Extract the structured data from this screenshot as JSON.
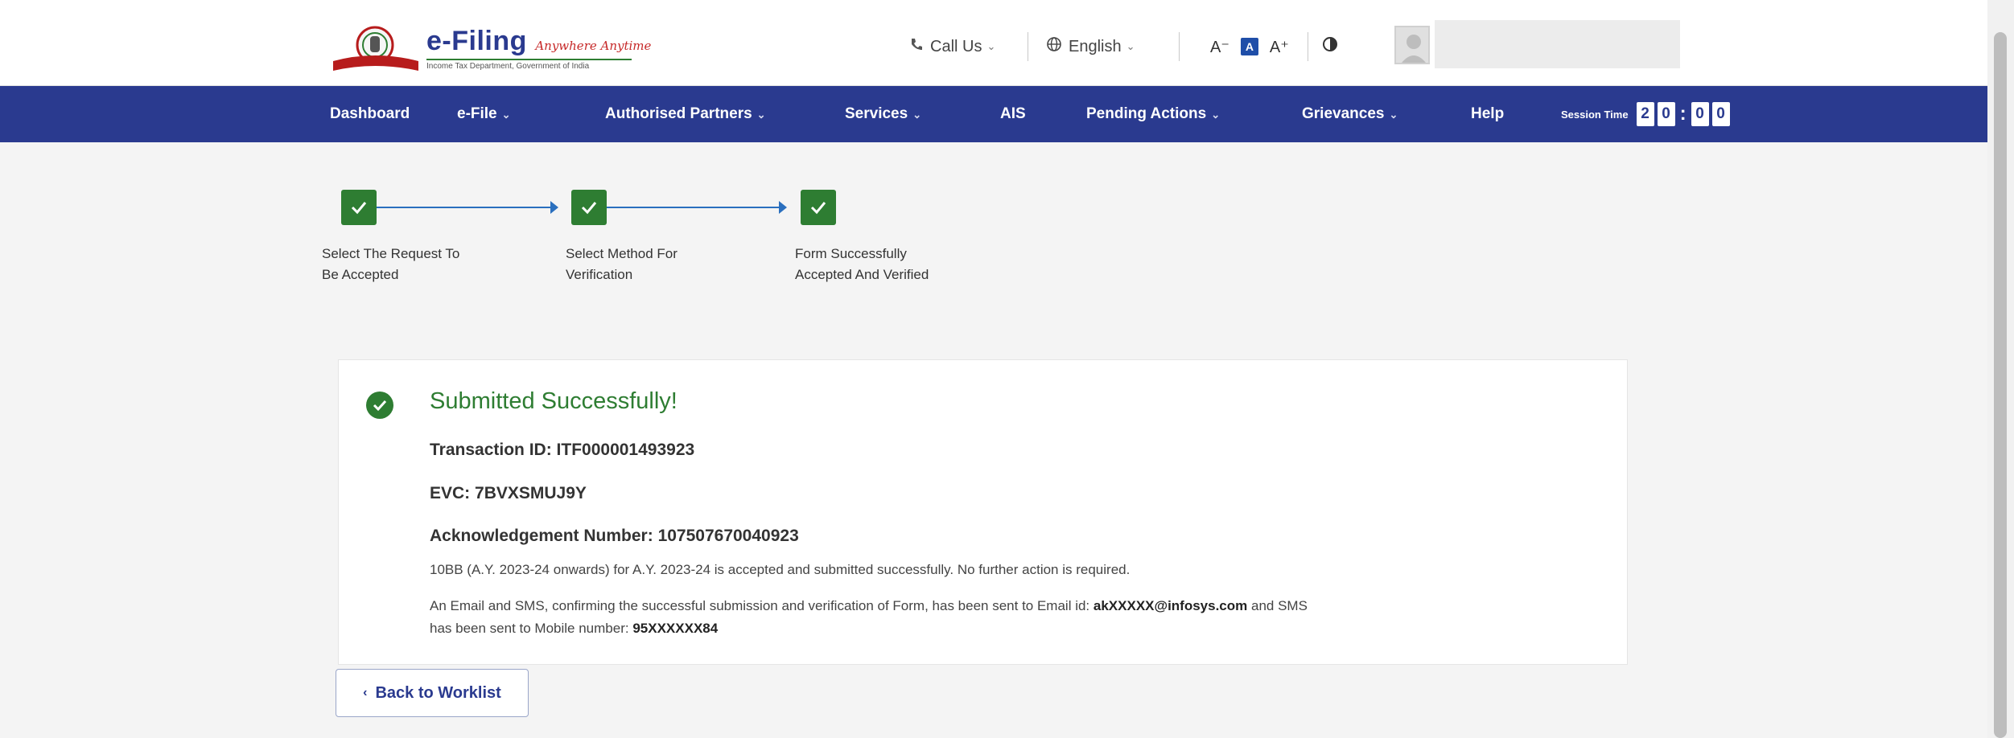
{
  "header": {
    "brand_title": "e-Filing",
    "brand_tagline": "Anywhere Anytime",
    "brand_subtitle": "Income Tax Department, Government of India",
    "call_us": "Call Us",
    "call_icon": "phone-icon",
    "language": "English",
    "language_icon": "globe-icon",
    "font_decrease": "A⁻",
    "font_default": "A",
    "font_increase": "A⁺",
    "contrast_icon": "contrast-icon",
    "avatar_icon": "user-avatar-icon"
  },
  "nav": {
    "items": [
      {
        "label": "Dashboard",
        "dropdown": false
      },
      {
        "label": "e-File",
        "dropdown": true
      },
      {
        "label": "Authorised Partners",
        "dropdown": true
      },
      {
        "label": "Services",
        "dropdown": true
      },
      {
        "label": "AIS",
        "dropdown": false
      },
      {
        "label": "Pending Actions",
        "dropdown": true
      },
      {
        "label": "Grievances",
        "dropdown": true
      },
      {
        "label": "Help",
        "dropdown": false
      }
    ],
    "session_label": "Session Time",
    "session_digits": [
      "2",
      "0",
      "0",
      "0"
    ]
  },
  "stepper": {
    "steps": [
      {
        "label_line1": "Select The Request To",
        "label_line2": "Be Accepted",
        "status": "completed"
      },
      {
        "label_line1": "Select Method For",
        "label_line2": "Verification",
        "status": "completed"
      },
      {
        "label_line1": "Form Successfully",
        "label_line2": "Accepted And Verified",
        "status": "completed"
      }
    ]
  },
  "result": {
    "title": "Submitted Successfully!",
    "transaction_label": "Transaction ID:",
    "transaction_id": "ITF000001493923",
    "evc_label": "EVC:",
    "evc": "7BVXSMUJ9Y",
    "ack_label": "Acknowledgement Number:",
    "ack_number": "107507670040923",
    "message": "10BB (A.Y. 2023-24 onwards) for A.Y. 2023-24 is accepted and submitted successfully. No further action is required.",
    "notice_part1": "An Email and SMS, confirming the successful submission and verification of Form, has been sent to Email id:",
    "email": "akXXXXX@infosys.com",
    "notice_part2": "and SMS",
    "notice_part3": "has been sent to Mobile number:",
    "mobile": "95XXXXXX84"
  },
  "actions": {
    "back_label": "Back to Worklist"
  },
  "colors": {
    "brand_blue": "#2a3a8f",
    "success_green": "#2e7d32",
    "step_line_blue": "#2a6fbe"
  }
}
